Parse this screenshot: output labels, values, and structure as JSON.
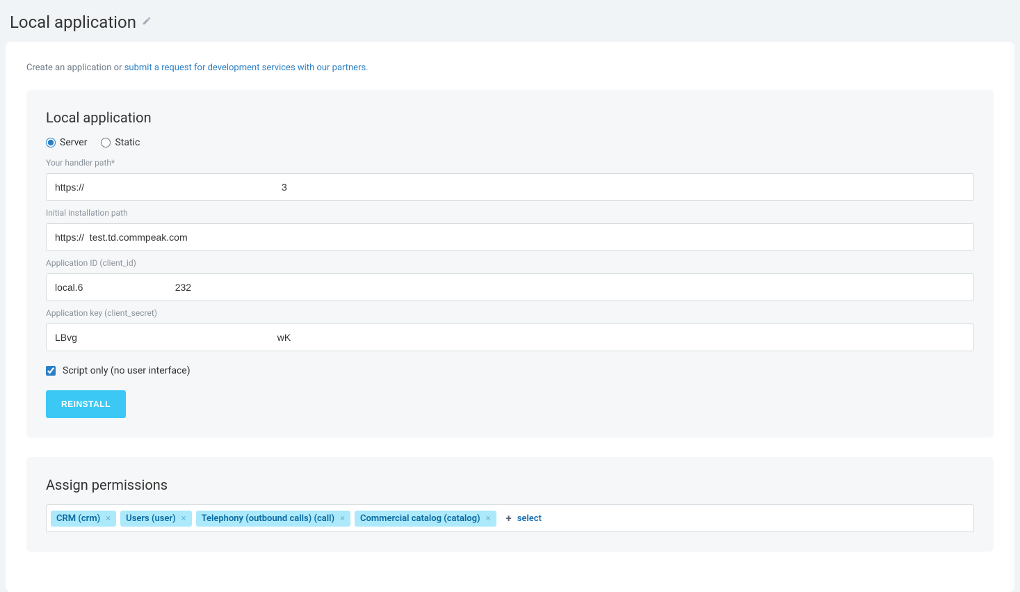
{
  "header": {
    "title": "Local application"
  },
  "intro": {
    "prefix": "Create an application or ",
    "link_text": "submit a request for development services with our partners",
    "suffix": "."
  },
  "form": {
    "section_title": "Local application",
    "radio": {
      "server_label": "Server",
      "static_label": "Static",
      "selected": "server"
    },
    "handler_path": {
      "label": "Your handler path*",
      "value": "https://                                                                         3"
    },
    "install_path": {
      "label": "Initial installation path",
      "value": "https://  test.td.commpeak.com"
    },
    "client_id": {
      "label": "Application ID (client_id)",
      "value": "local.6                                  232"
    },
    "client_secret": {
      "label": "Application key (client_secret)",
      "value": "LBvg                                                                          wK"
    },
    "script_only": {
      "label": "Script only (no user interface)",
      "checked": true
    },
    "reinstall_button": "Reinstall"
  },
  "permissions": {
    "section_title": "Assign permissions",
    "tags": [
      {
        "label": "CRM (crm)"
      },
      {
        "label": "Users (user)"
      },
      {
        "label": "Telephony (outbound calls) (call)"
      },
      {
        "label": "Commercial catalog (catalog)"
      }
    ],
    "add_label": "select"
  }
}
